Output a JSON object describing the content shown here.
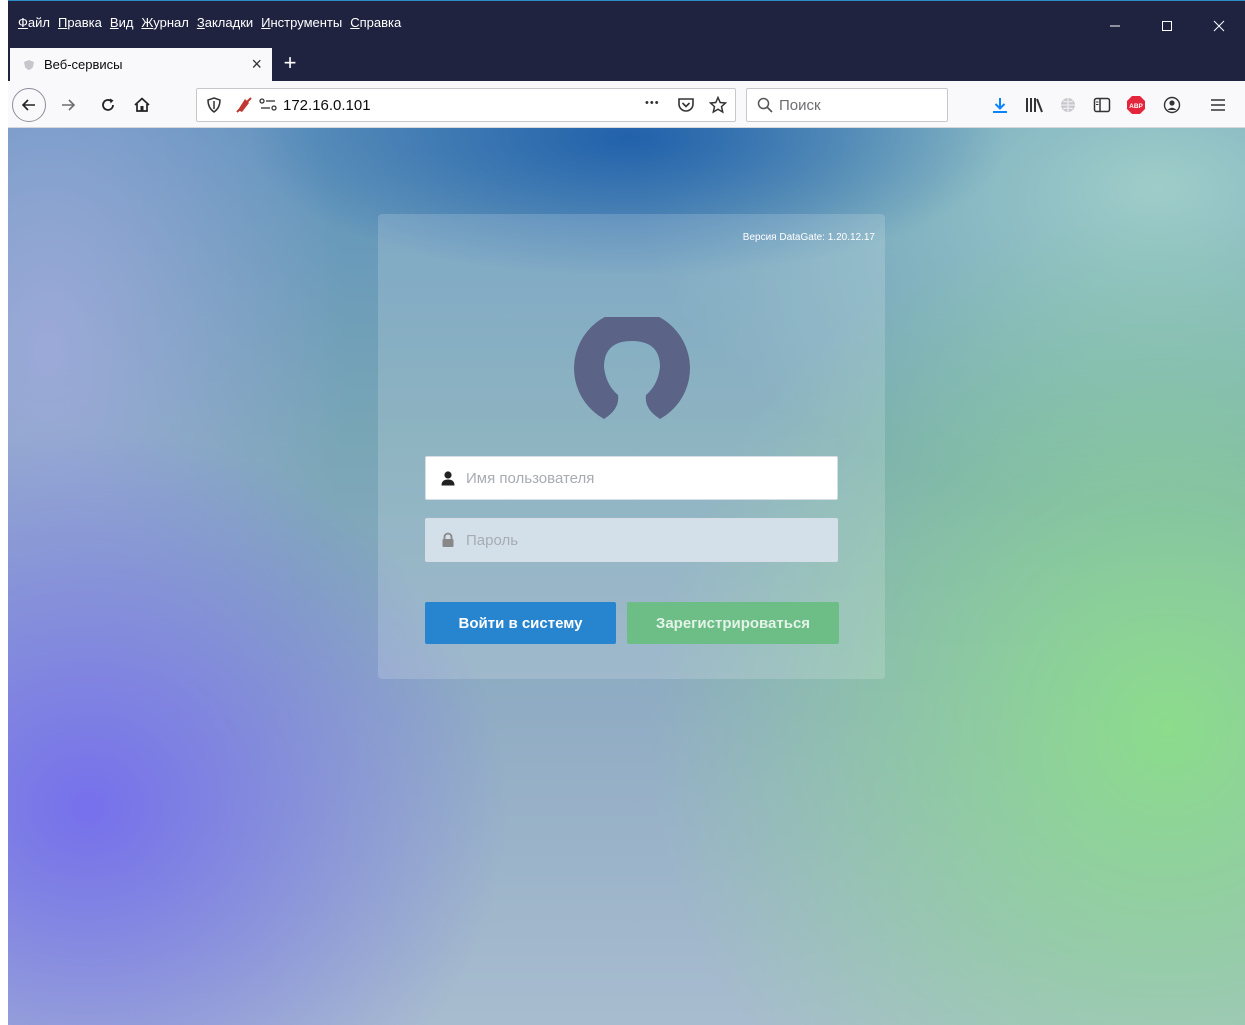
{
  "menu": {
    "items": [
      {
        "first": "Ф",
        "rest": "айл"
      },
      {
        "first": "П",
        "rest": "равка"
      },
      {
        "first": "В",
        "rest": "ид"
      },
      {
        "first": "Ж",
        "rest": "урнал"
      },
      {
        "first": "З",
        "rest": "акладки"
      },
      {
        "first": "И",
        "rest": "нструменты"
      },
      {
        "first": "С",
        "rest": "правка"
      }
    ]
  },
  "tab": {
    "title": "Веб-сервисы",
    "close": "×"
  },
  "newtab": "+",
  "urlbar": {
    "url": "172.16.0.101",
    "more": "•••"
  },
  "search": {
    "placeholder": "Поиск"
  },
  "login": {
    "version": "Версия DataGate: 1.20.12.17",
    "username_placeholder": "Имя пользователя",
    "password_placeholder": "Пароль",
    "login_button": "Войти в систему",
    "register_button": "Зарегистрироваться"
  },
  "colors": {
    "chrome_dark": "#1f2340",
    "login_blue": "#2784cf",
    "register_green": "#6dbd87",
    "avatar": "#5b6486",
    "download_blue": "#0a84ff",
    "abp_red": "#e4263c"
  },
  "icons": [
    "shield-icon",
    "mic-off-icon",
    "connection-icon",
    "pocket-icon",
    "bookmark-star-icon",
    "download-icon",
    "library-icon",
    "globe-icon",
    "sidebar-icon",
    "adblock-icon",
    "account-icon",
    "hamburger-menu-icon"
  ]
}
